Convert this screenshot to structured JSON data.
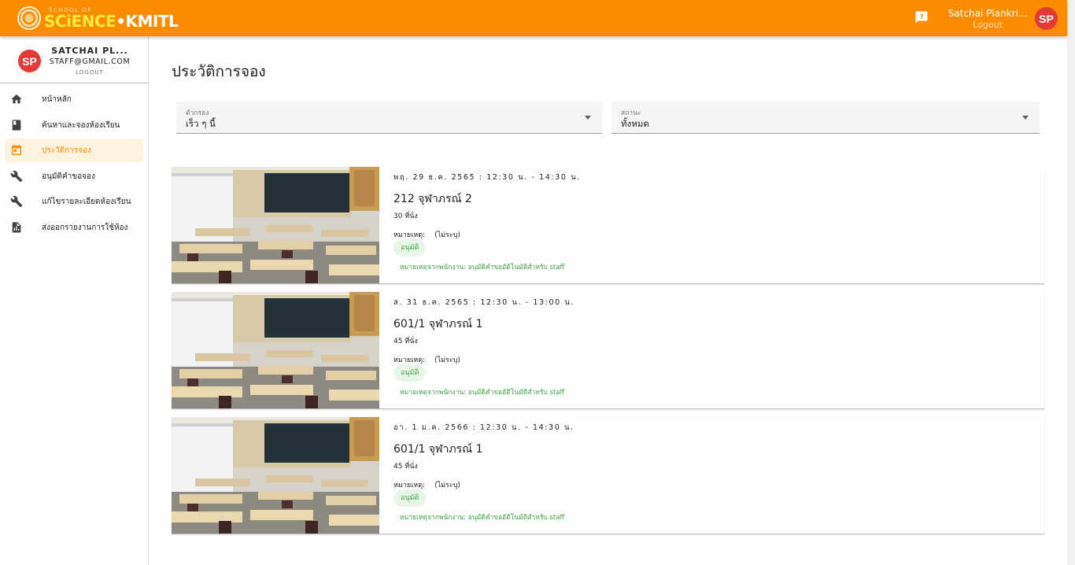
{
  "header": {
    "logo_top": "SCHOOL OF",
    "logo_sci": "SCiENCE",
    "logo_dot": "•",
    "logo_kmitl": "KMITL",
    "user_name": "Satchai Plankri...",
    "logout": "Logout",
    "avatar": "SP",
    "brand_color": "#fb8c00"
  },
  "sidebar": {
    "profile": {
      "avatar": "SP",
      "name": "SATCHAI PL...",
      "email": "STAFF@GMAIL.COM",
      "logout": "LOGOUT"
    },
    "items": [
      {
        "label": "หน้าหลัก",
        "icon": "home-icon",
        "active": false
      },
      {
        "label": "ค้นหาและจองห้องเรียน",
        "icon": "book-icon",
        "active": false
      },
      {
        "label": "ประวัติการจอง",
        "icon": "calendar-icon",
        "active": true
      },
      {
        "label": "อนุมัติคำขอจอง",
        "icon": "wrench-icon",
        "active": false
      },
      {
        "label": "แก้ไขรายละเอียดห้องเรียน",
        "icon": "wrench-icon",
        "active": false
      },
      {
        "label": "ส่งออกรายงานการใช้ห้อง",
        "icon": "report-icon",
        "active": false
      }
    ]
  },
  "main": {
    "title": "ประวัติการจอง",
    "filter": {
      "label": "ตัวกรอง",
      "value": "เร็ว ๆ นี้"
    },
    "status": {
      "label": "สถานะ",
      "value": "ทั้งหมด"
    },
    "bookings": [
      {
        "date": "พฤ. 29 ธ.ค. 2565 : 12:30 น. - 14:30 น.",
        "room": "212 จุฬาภรณ์ 2",
        "seats": "30 ที่นั่ง",
        "note_label": "หมายเหตุ:",
        "note_value": "(ไม่ระบุ)",
        "status": "อนุมัติ",
        "staff_note": "หมายเหตุจากพนักงาน: อนุมัติคำขออัติโนมัติสำหรับ staff"
      },
      {
        "date": "ส. 31 ธ.ค. 2565 : 12:30 น. - 13:00 น.",
        "room": "601/1 จุฬาภรณ์ 1",
        "seats": "45 ที่นั่ง",
        "note_label": "หมายเหตุ:",
        "note_value": "(ไม่ระบุ)",
        "status": "อนุมัติ",
        "staff_note": "หมายเหตุจากพนักงาน: อนุมัติคำขออัติโนมัติสำหรับ staff"
      },
      {
        "date": "อา. 1 ม.ค. 2566 : 12:30 น. - 14:30 น.",
        "room": "601/1 จุฬาภรณ์ 1",
        "seats": "45 ที่นั่ง",
        "note_label": "หมายเหตุ:",
        "note_value": "(ไม่ระบุ)",
        "status": "อนุมัติ",
        "staff_note": "หมายเหตุจากพนักงาน: อนุมัติคำขออัติโนมัติสำหรับ staff"
      }
    ]
  }
}
